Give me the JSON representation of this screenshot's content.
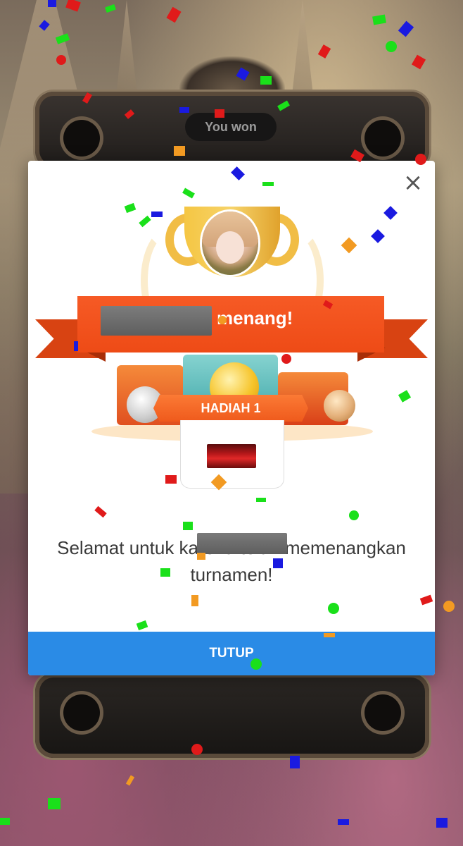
{
  "header": {
    "title": "You won"
  },
  "modal": {
    "close_glyph": "×",
    "winner_banner": "menang!",
    "prize_label": "HADIAH 1",
    "message": "Selamat untuk                    karena telah memenangkan turnamen!",
    "close_button": "TUTUP"
  },
  "colors": {
    "accent_blue": "#2a8be6",
    "ribbon_orange": "#ee4b16",
    "trophy_gold": "#f5c643"
  },
  "icons": {
    "close": "close-icon",
    "trophy": "trophy-icon",
    "coin": "coin-icon"
  }
}
